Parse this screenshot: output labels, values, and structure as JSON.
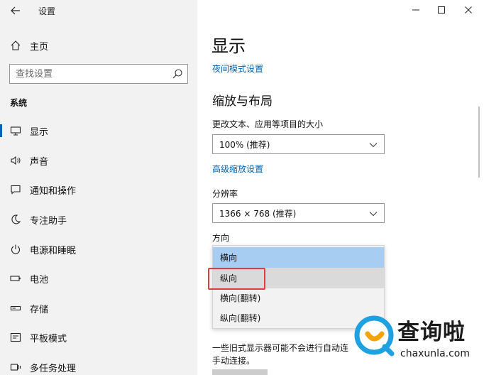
{
  "app": {
    "title": "设置"
  },
  "sidebar": {
    "home_label": "主页",
    "search_placeholder": "查找设置",
    "section_title": "系统",
    "items": [
      {
        "label": "显示",
        "icon": "monitor-icon",
        "selected": true
      },
      {
        "label": "声音",
        "icon": "speaker-icon"
      },
      {
        "label": "通知和操作",
        "icon": "message-icon"
      },
      {
        "label": "专注助手",
        "icon": "moon-icon"
      },
      {
        "label": "电源和睡眠",
        "icon": "power-icon"
      },
      {
        "label": "电池",
        "icon": "battery-icon"
      },
      {
        "label": "存储",
        "icon": "storage-icon"
      },
      {
        "label": "平板模式",
        "icon": "tablet-icon"
      },
      {
        "label": "多任务处理",
        "icon": "multitask-icon"
      }
    ]
  },
  "main": {
    "title": "显示",
    "night_link": "夜间模式设置",
    "scale_heading": "缩放与布局",
    "text_size_label": "更改文本、应用等项目的大小",
    "scale_value": "100% (推荐)",
    "advanced_link": "高级缩放设置",
    "resolution_label": "分辨率",
    "resolution_value": "1366 × 768 (推荐)",
    "orientation_label": "方向",
    "orientation_options": [
      {
        "label": "横向",
        "state": "selected"
      },
      {
        "label": "纵向",
        "state": "hover"
      },
      {
        "label": "横向(翻转)",
        "state": "normal"
      },
      {
        "label": "纵向(翻转)",
        "state": "normal"
      }
    ],
    "note_line1": "一些旧式显示器可能不会进行自动连",
    "note_line2": "手动连接。"
  },
  "watermark": {
    "cn": "查询啦",
    "en": "chaxunla.com"
  },
  "colors": {
    "accent": "#0063b1",
    "dropdown_selected": "#a8cdf2",
    "highlight": "#e53a3a",
    "sidebar_bg": "#f2f2f2"
  }
}
